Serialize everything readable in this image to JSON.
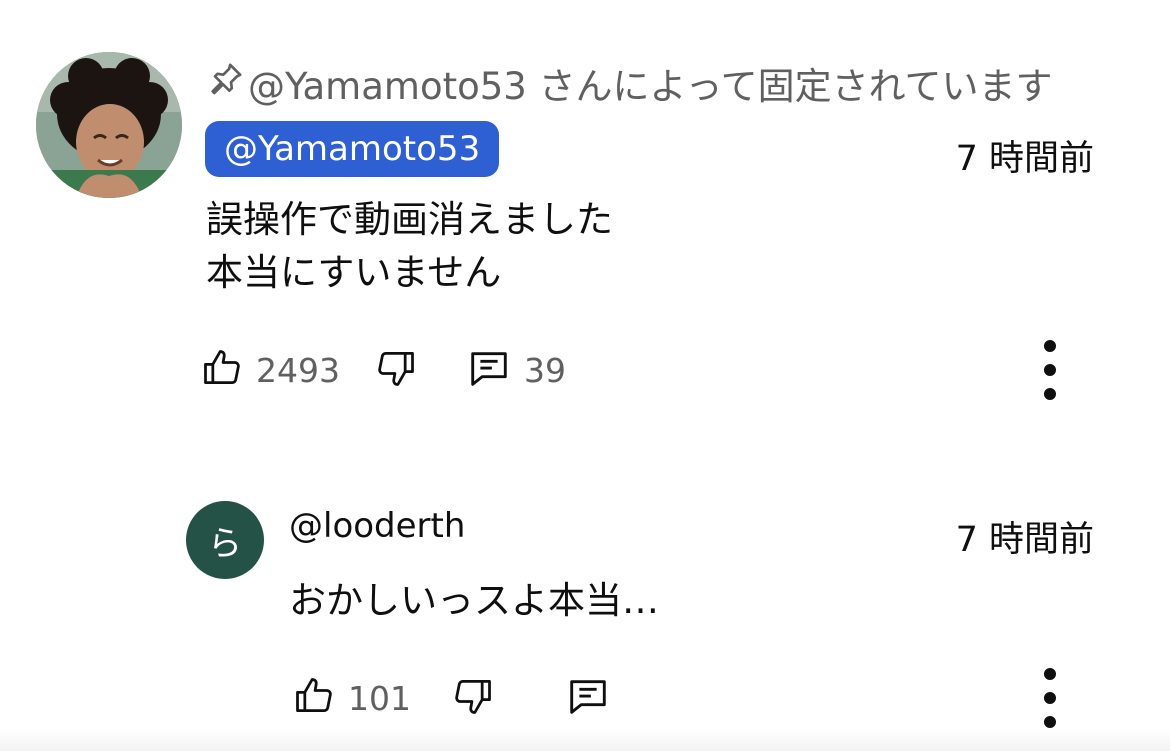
{
  "pinned_comment": {
    "pinned_label": "@Yamamoto53 さんによって固定されています",
    "author": "@Yamamoto53",
    "time": "7 時間前",
    "text_line1": "誤操作で動画消えました",
    "text_line2": "本当にすいません",
    "like_count": "2493",
    "reply_count": "39"
  },
  "reply": {
    "avatar_letter": "ら",
    "author": "@looderth",
    "time": "7 時間前",
    "text": "おかしいっスよ本当…",
    "like_count": "101"
  },
  "icons": {
    "pin": "pin-icon",
    "like": "thumb-up-icon",
    "dislike": "thumb-down-icon",
    "reply": "comment-icon",
    "more": "more-vert-icon"
  },
  "colors": {
    "author_chip": "#2e5fd3",
    "reply_avatar": "#245246",
    "secondary_text": "#606060"
  }
}
